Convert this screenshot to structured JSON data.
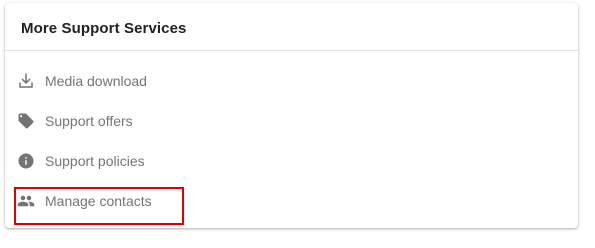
{
  "card": {
    "title": "More Support Services"
  },
  "menu": {
    "items": [
      {
        "label": "Media download",
        "icon": "download-icon"
      },
      {
        "label": "Support offers",
        "icon": "tag-icon"
      },
      {
        "label": "Support policies",
        "icon": "info-icon"
      },
      {
        "label": "Manage contacts",
        "icon": "people-icon"
      }
    ]
  },
  "colors": {
    "highlight": "#e00000",
    "icon": "#737373",
    "text": "#757575",
    "title": "#222222"
  }
}
